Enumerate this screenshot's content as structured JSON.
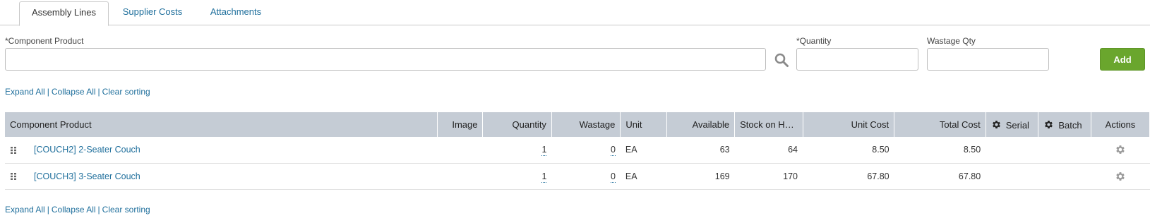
{
  "tabs": [
    {
      "label": "Assembly Lines"
    },
    {
      "label": "Supplier Costs"
    },
    {
      "label": "Attachments"
    }
  ],
  "form": {
    "component_label": "*Component Product",
    "component_value": "",
    "quantity_label": "*Quantity",
    "quantity_value": "",
    "wastage_label": "Wastage Qty",
    "wastage_value": "",
    "add_label": "Add"
  },
  "links": {
    "expand_all": "Expand All",
    "collapse_all": "Collapse All",
    "clear_sorting": "Clear sorting",
    "separator": "|"
  },
  "table": {
    "columns": [
      "Component Product",
      "Image",
      "Quantity",
      "Wastage",
      "Unit",
      "Available",
      "Stock on Ha...",
      "Unit Cost",
      "Total Cost",
      "Serial",
      "Batch",
      "Actions"
    ],
    "rows": [
      {
        "product": "[COUCH2] 2-Seater Couch",
        "image": "",
        "quantity": "1",
        "wastage": "0",
        "unit": "EA",
        "available": "63",
        "stock": "64",
        "unit_cost": "8.50",
        "total_cost": "8.50",
        "serial": "",
        "batch": ""
      },
      {
        "product": "[COUCH3] 3-Seater Couch",
        "image": "",
        "quantity": "1",
        "wastage": "0",
        "unit": "EA",
        "available": "169",
        "stock": "170",
        "unit_cost": "67.80",
        "total_cost": "67.80",
        "serial": "",
        "batch": ""
      }
    ]
  },
  "icons": {
    "search": "search-icon",
    "gear": "gear-icon",
    "drag": "drag-handle-icon"
  },
  "colors": {
    "link": "#1f6f9c",
    "add_button": "#6aa62d",
    "header_bg": "#c5ccd5"
  }
}
